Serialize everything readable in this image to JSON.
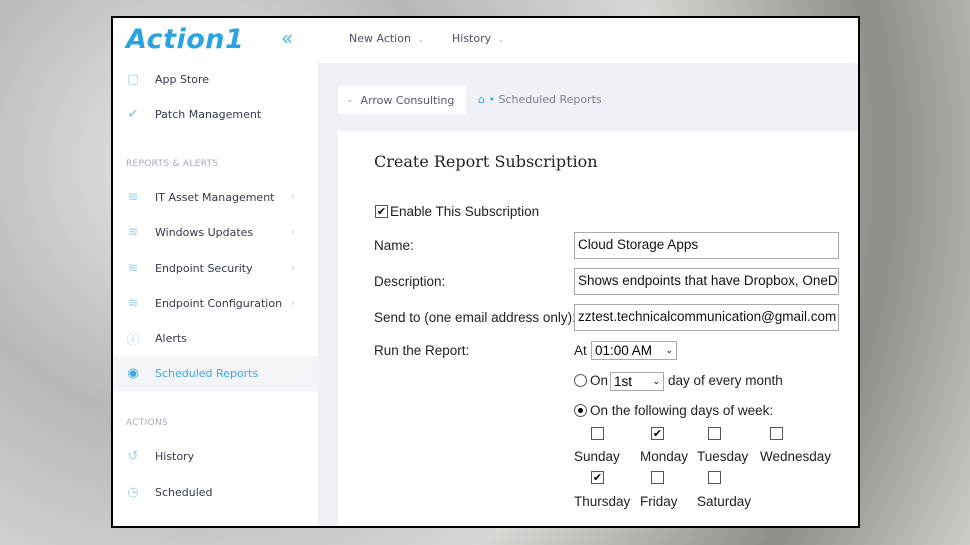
{
  "app": {
    "logo": "Action1",
    "collapse_icon": "double-chevron-left-icon",
    "accent": "#2aa3e0"
  },
  "sidebar": {
    "items_top": [
      {
        "label": "App Store",
        "icon": "shopping-bag-icon"
      },
      {
        "label": "Patch Management",
        "icon": "double-check-icon"
      }
    ],
    "section_reports": "REPORTS & ALERTS",
    "reports": [
      {
        "label": "IT Asset Management",
        "icon": "layers-icon"
      },
      {
        "label": "Windows Updates",
        "icon": "layers-icon"
      },
      {
        "label": "Endpoint Security",
        "icon": "layers-icon"
      },
      {
        "label": "Endpoint Configuration",
        "icon": "layers-icon"
      },
      {
        "label": "Alerts",
        "icon": "alert-circle-icon"
      },
      {
        "label": "Scheduled Reports",
        "icon": "scheduled-report-icon",
        "active": true
      }
    ],
    "section_actions": "ACTIONS",
    "actions": [
      {
        "label": "History",
        "icon": "history-icon"
      },
      {
        "label": "Scheduled",
        "icon": "clock-icon"
      }
    ]
  },
  "topbar": {
    "menus": [
      {
        "label": "New Action"
      },
      {
        "label": "History"
      }
    ]
  },
  "breadcrumb": {
    "org": "Arrow Consulting",
    "separator": "•",
    "page": "Scheduled Reports"
  },
  "form": {
    "title": "Create Report Subscription",
    "enable_label": "Enable This Subscription",
    "enable_checked": true,
    "name_label": "Name:",
    "name_value": "Cloud Storage Apps",
    "description_label": "Description:",
    "description_value": "Shows endpoints that have Dropbox, OneDr",
    "sendto_label": "Send to (one email address only):",
    "sendto_value": "zztest.technicalcommunication@gmail.com",
    "run_label": "Run the Report:",
    "at_label": "At",
    "time_value": "01:00 AM",
    "monthly_on_label": "On",
    "monthly_day_value": "1st",
    "monthly_suffix": "day of every month",
    "monthly_selected": false,
    "weekly_label": "On the following days of week:",
    "weekly_selected": true,
    "days": [
      {
        "label": "Sunday",
        "checked": false
      },
      {
        "label": "Monday",
        "checked": true
      },
      {
        "label": "Tuesday",
        "checked": false
      },
      {
        "label": "Wednesday",
        "checked": false
      },
      {
        "label": "Thursday",
        "checked": true
      },
      {
        "label": "Friday",
        "checked": false
      },
      {
        "label": "Saturday",
        "checked": false
      }
    ]
  }
}
